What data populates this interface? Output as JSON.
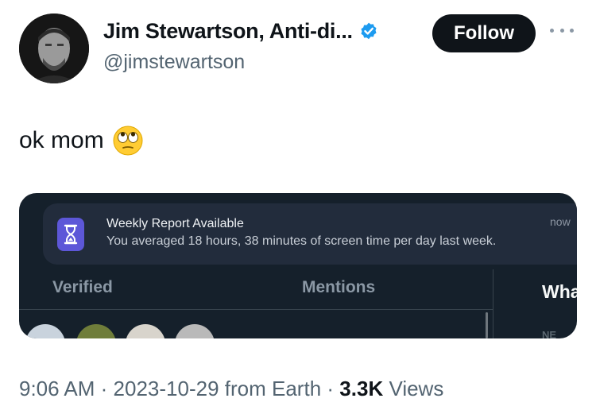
{
  "author": {
    "display_name": "Jim Stewartson, Anti-di...",
    "handle": "@jimstewartson",
    "verified": true
  },
  "actions": {
    "follow_label": "Follow"
  },
  "tweet": {
    "text": "ok mom",
    "emoji": "face-with-rolling-eyes"
  },
  "media": {
    "notification": {
      "title": "Weekly Report Available",
      "body": "You averaged 18 hours, 38 minutes of screen time per day last week.",
      "time": "now",
      "icon": "hourglass-icon"
    },
    "tabs": [
      "Verified",
      "Mentions",
      "Wha"
    ],
    "partial_label": "NE"
  },
  "meta": {
    "time": "9:06 AM",
    "date": "2023-10-29",
    "source": "from Earth",
    "views_count": "3.3K",
    "views_label": "Views",
    "separator": "·"
  },
  "colors": {
    "verified_badge": "#1d9bf0",
    "follow_button": "#0f1419",
    "media_bg": "#15202b",
    "notification_bg": "#222c3c",
    "hourglass_bg": "#5d57d8"
  }
}
